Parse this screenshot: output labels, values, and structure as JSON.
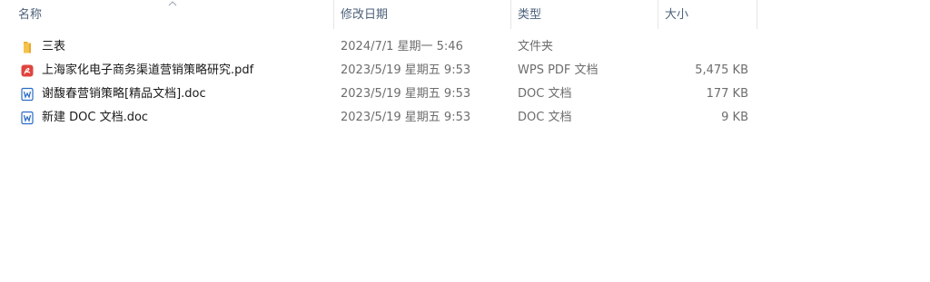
{
  "columns": {
    "name": "名称",
    "date": "修改日期",
    "type": "类型",
    "size": "大小"
  },
  "files": [
    {
      "icon": "folder-icon",
      "name": "三表",
      "date": "2024/7/1 星期一 5:46",
      "type": "文件夹",
      "size": ""
    },
    {
      "icon": "pdf-file-icon",
      "name": "上海家化电子商务渠道营销策略研究.pdf",
      "date": "2023/5/19 星期五 9:53",
      "type": "WPS PDF 文档",
      "size": "5,475 KB"
    },
    {
      "icon": "word-doc-icon",
      "name": "谢馥春营销策略[精品文档].doc",
      "date": "2023/5/19 星期五 9:53",
      "type": "DOC 文档",
      "size": "177 KB"
    },
    {
      "icon": "word-doc-icon",
      "name": "新建 DOC 文档.doc",
      "date": "2023/5/19 星期五 9:53",
      "type": "DOC 文档",
      "size": "9 KB"
    }
  ],
  "colors": {
    "header_text": "#4c607a",
    "folder": "#f5c24c",
    "pdf": "#e0443e",
    "word": "#2b6cc4"
  }
}
